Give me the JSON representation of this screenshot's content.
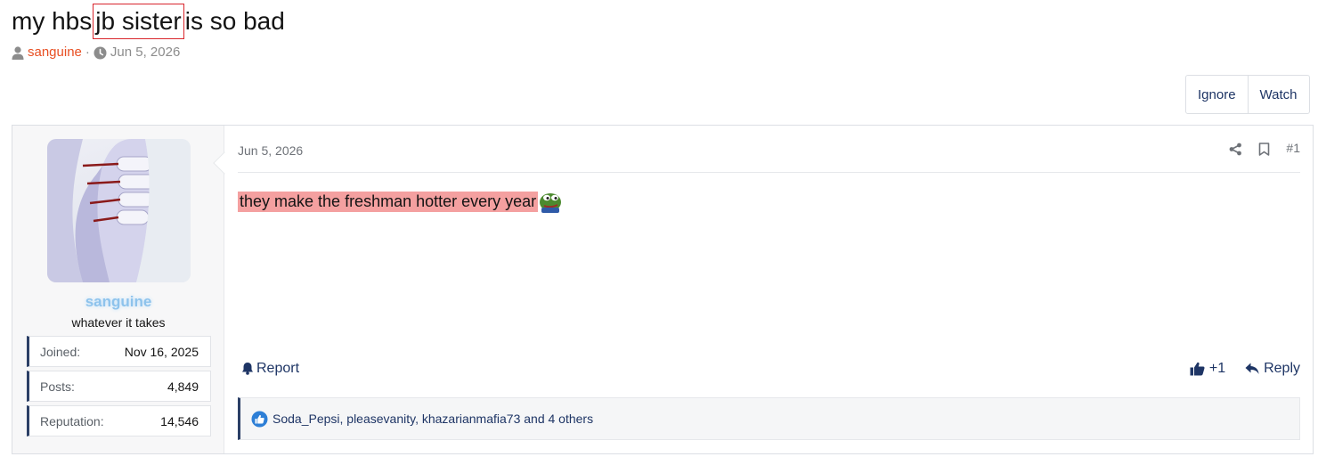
{
  "thread": {
    "title_before": "my hbs",
    "title_highlight": "jb sister",
    "title_after": "is so bad",
    "author": "sanguine",
    "separator": "·",
    "date": "Jun 5, 2026"
  },
  "buttons": {
    "ignore": "Ignore",
    "watch": "Watch"
  },
  "post": {
    "user": {
      "name": "sanguine",
      "title": "whatever it takes",
      "stats": [
        {
          "label": "Joined:",
          "value": "Nov 16, 2025"
        },
        {
          "label": "Posts:",
          "value": "4,849"
        },
        {
          "label": "Reputation:",
          "value": "14,546"
        }
      ]
    },
    "date": "Jun 5, 2026",
    "number": "#1",
    "body": "they make the freshman hotter every year",
    "report_label": "Report",
    "like_label": "+1",
    "reply_label": "Reply",
    "reactions_text": "Soda_Pepsi, pleasevanity, khazarianmafia73 and 4 others"
  },
  "colors": {
    "accent": "#1e3565",
    "author": "#e84f23",
    "highlight_box": "#d9262d",
    "text_highlight": "#f4a0a0",
    "username": "#8ec3ec"
  },
  "icons": [
    "user-icon",
    "clock-icon",
    "share-icon",
    "bookmark-icon",
    "bell-icon",
    "thumbs-up-icon",
    "reply-icon",
    "like-reaction-icon",
    "pepe-emoji"
  ]
}
